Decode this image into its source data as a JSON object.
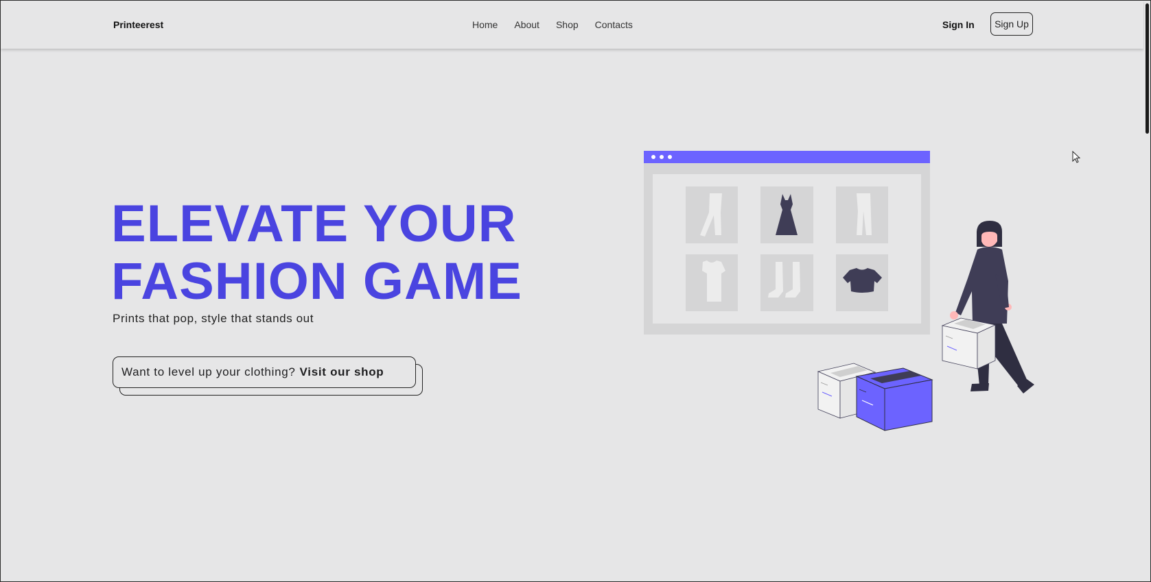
{
  "navbar": {
    "brand": "Printeerest",
    "links": [
      "Home",
      "About",
      "Shop",
      "Contacts"
    ],
    "sign_in": "Sign In",
    "sign_up": "Sign Up"
  },
  "hero": {
    "title_line1": "ELEVATE YOUR",
    "title_line2": "FASHION GAME",
    "subtitle": "Prints that pop, style that stands out",
    "cta_text": "Want to level up your clothing?",
    "cta_link": "Visit our shop"
  },
  "illustration": {
    "name": "online-shopping-illustration",
    "items": [
      "pants-icon",
      "dress-icon",
      "trousers-icon",
      "tshirt-icon",
      "boots-icon",
      "crop-top-icon"
    ]
  },
  "colors": {
    "accent": "#4a44e0",
    "illustration_accent": "#6c63ff",
    "background": "#e6e6e7",
    "dark": "#3f3d56"
  }
}
